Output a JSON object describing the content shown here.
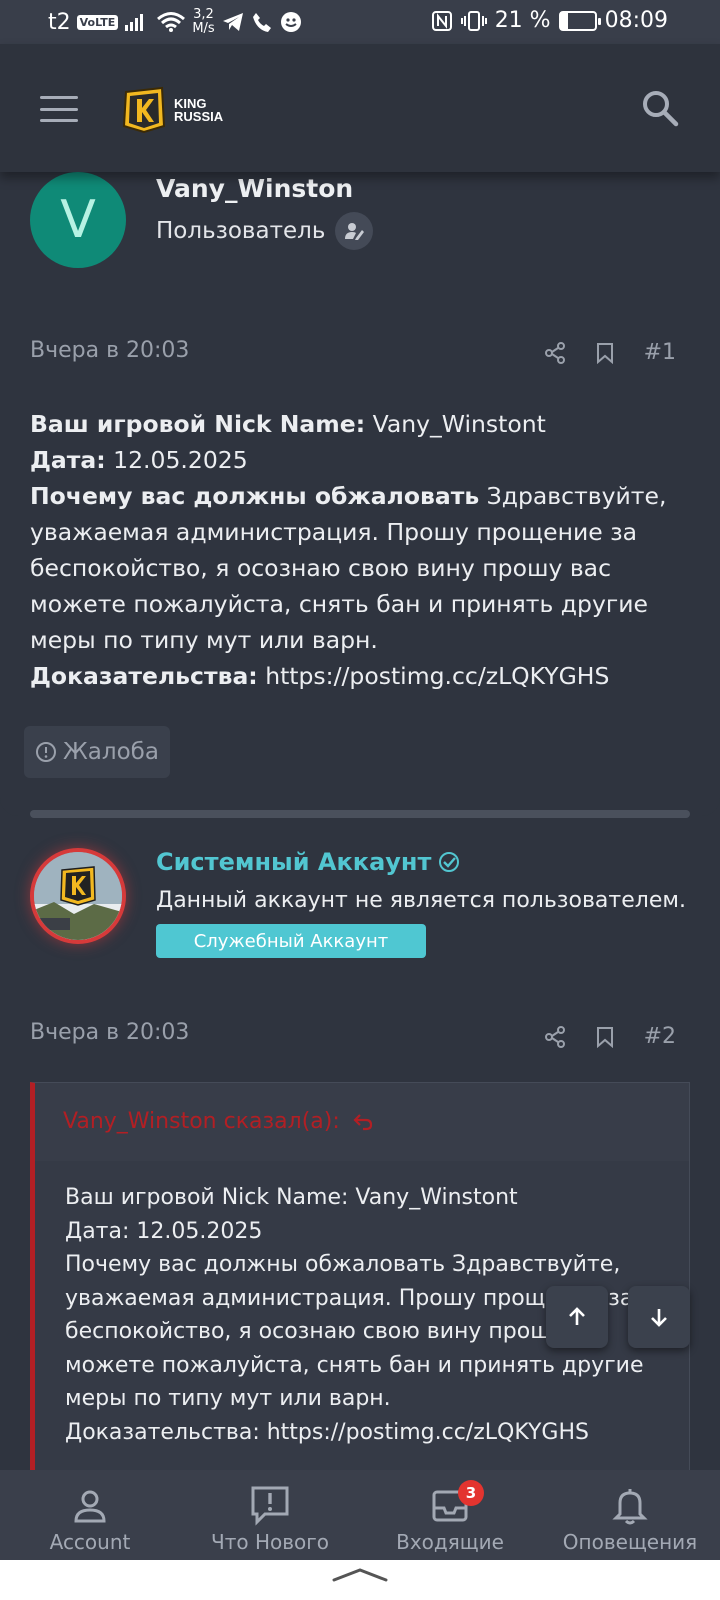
{
  "status_bar": {
    "carrier": "t2",
    "volte": "VoLTE",
    "speed_value": "3,2",
    "speed_unit": "M/s",
    "battery": "21 %",
    "time": "08:09"
  },
  "header": {
    "logo_line1": "KING",
    "logo_line2": "RUSSIA"
  },
  "post1": {
    "avatar_letter": "V",
    "username": "Vany_Winston",
    "user_title": "Пользователь",
    "date": "Вчера в 20:03",
    "number": "#1",
    "fields": [
      {
        "label": "Ваш игровой Nick Name:",
        "value": "Vany_Winstont"
      },
      {
        "label": "Дата:",
        "value": "12.05.2025"
      },
      {
        "label": "Почему вас должны обжаловать",
        "value": "Здравствуйте, уважаемая администрация. Прошу прощение за беспокойство, я осознаю свою вину прошу вас можете пожалуйста, снять бан и принять другие меры по типу мут или варн."
      },
      {
        "label": "Доказательства:",
        "value": "https://postimg.cc/zLQKYGHS"
      }
    ],
    "report_label": "Жалоба"
  },
  "post2": {
    "username": "Системный Аккаунт",
    "description": "Данный аккаунт не является пользователем.",
    "badge": "Служебный Аккаунт",
    "date": "Вчера в 20:03",
    "number": "#2",
    "quote_author": "Vany_Winston сказал(а):",
    "quote_lines": [
      "Ваш игровой Nick Name: Vany_Winstont",
      "Дата: 12.05.2025",
      "Почему вас должны обжаловать Здравствуйте, уважаемая администрация. Прошу прощение за беспокойство, я осознаю свою вину прошу вас можете пожалуйста, снять бан и принять другие меры по типу мут или варн.",
      "Доказательства: https://postimg.cc/zLQKYGHS"
    ]
  },
  "bottom_nav": [
    {
      "label": "Account",
      "icon": "user-icon"
    },
    {
      "label": "Что Нового",
      "icon": "whats-new-icon"
    },
    {
      "label": "Входящие",
      "icon": "inbox-icon",
      "badge": "3"
    },
    {
      "label": "Оповещения",
      "icon": "bell-icon"
    }
  ],
  "colors": {
    "background": "#2f343f",
    "accent_teal": "#4fc7d2",
    "quote_red": "#b21f24",
    "avatar_green": "#0f8a77"
  }
}
